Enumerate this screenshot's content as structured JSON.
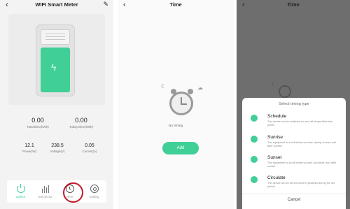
{
  "screen1": {
    "title": "WIFI Smart Meter",
    "back_icon": "chevron-left-icon",
    "edit_icon": "pencil-icon",
    "stats_main": [
      {
        "value": "0.00",
        "label": "Total Elec(kWh)"
      },
      {
        "value": "0.00",
        "label": "Today Elec(kWh)"
      }
    ],
    "stats_small": [
      {
        "value": "12.1",
        "label": "Power(W)"
      },
      {
        "value": "238.5",
        "label": "Voltage(V)"
      },
      {
        "value": "0.05",
        "label": "Current(A)"
      }
    ],
    "tabs": [
      {
        "label": "Switch",
        "icon": "power-icon"
      },
      {
        "label": "Electricity",
        "icon": "bar-chart-icon"
      },
      {
        "label": "Time",
        "icon": "clock-icon"
      },
      {
        "label": "Setting",
        "icon": "gear-icon"
      }
    ],
    "accent": "#3fcf97",
    "highlight_color": "#c2182c"
  },
  "screen2": {
    "title": "Time",
    "back_icon": "chevron-left-icon",
    "empty_text": "No timing",
    "add_label": "Add",
    "accent": "#3fcf97"
  },
  "screen3": {
    "title": "Time",
    "back_icon": "chevron-left-icon",
    "sheet_title": "Select timing type",
    "options": [
      {
        "name": "Schedule",
        "desc": "The device can be switched on and off at specified time points",
        "icon": "clock-icon"
      },
      {
        "name": "Sunrise",
        "desc": "The equipment is on/off before sunrise, during sunrise and after sunrise",
        "icon": "sunrise-icon"
      },
      {
        "name": "Sunset",
        "desc": "The equipment is on/off before sunset, at sunset, and after sunset",
        "icon": "sunset-icon"
      },
      {
        "name": "Circulate",
        "desc": "The device can be turned on/off repeatedly during the set period",
        "icon": "repeat-icon"
      }
    ],
    "cancel_label": "Cancel",
    "overlay_color": "#6e6e6e"
  }
}
